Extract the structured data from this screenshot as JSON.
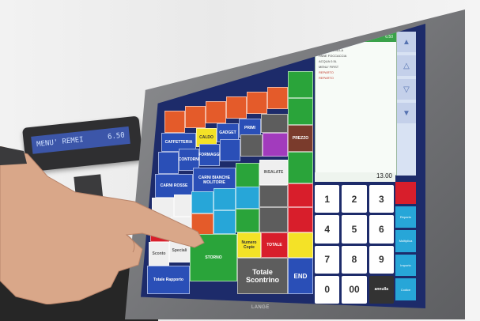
{
  "pole_display": {
    "left_text": "MENU' REMEI",
    "right_text": "6.50"
  },
  "receipt": {
    "header_left": "MENU' REMEI",
    "header_right": "6.50",
    "lines": [
      {
        "text": "MENU' PASTA",
        "red": false
      },
      {
        "text": "1 x CARNE ALLA",
        "red": false
      },
      {
        "text": "PANE FOCCACCIA",
        "red": false
      },
      {
        "text": "ACQUA 0.5L",
        "red": false
      },
      {
        "text": "MENU' FIRST",
        "red": false
      },
      {
        "text": "REPARTO",
        "red": true
      },
      {
        "text": "REPARTO",
        "red": true
      }
    ],
    "total": "13.00"
  },
  "tiles": {
    "caffetteria": "CAFFETTERIA",
    "caldo": "CALDO",
    "gadget": "GADGET",
    "primi": "PRIMI",
    "contorni": "CONTORNI",
    "formaggi": "FORMAGGI",
    "carni_bianche": "CARNI BIANCHE MOLITORIE",
    "carni_rosse": "CARNI ROSSE",
    "insalate": "INSALATE",
    "prezzo": "PREZZO",
    "sconto": "Sconto",
    "speciali": "Speciali",
    "totale": "TOTALE",
    "numero": "Numero Copie",
    "storno": "STORNO",
    "totale_scontrino": "Totale Scontrino",
    "totale_rapporto": "Totale Rapporto",
    "end": "END"
  },
  "keypad": [
    "1",
    "2",
    "3",
    "4",
    "5",
    "6",
    "7",
    "8",
    "9",
    "0",
    "00",
    "annulla"
  ],
  "functions": [
    "",
    "Reparto",
    "Moltiplica",
    "Importo",
    "Codice"
  ],
  "monitor_brand": "LANGE"
}
